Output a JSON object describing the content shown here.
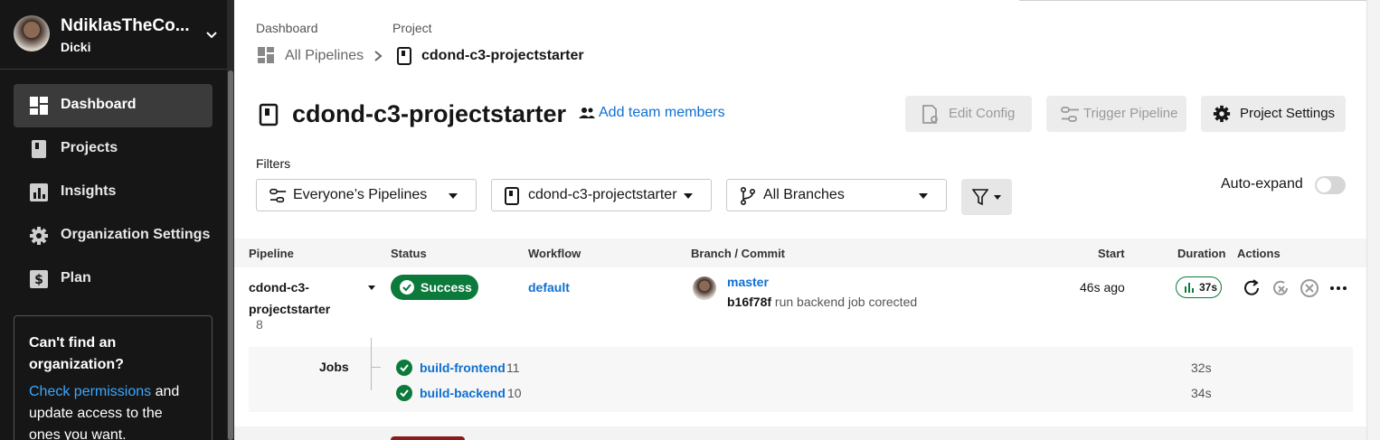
{
  "org": {
    "name": "NdiklasTheCo...",
    "user": "Dicki"
  },
  "sidebar": {
    "items": [
      {
        "label": "Dashboard",
        "icon": "dashboard-icon",
        "active": true
      },
      {
        "label": "Projects",
        "icon": "projects-icon"
      },
      {
        "label": "Insights",
        "icon": "insights-icon"
      },
      {
        "label": "Organization Settings",
        "icon": "gear-icon"
      },
      {
        "label": "Plan",
        "icon": "dollar-icon"
      }
    ],
    "help": {
      "heading": "Can't find an organization?",
      "link": "Check permissions",
      "text": " and update access to the ones you want."
    }
  },
  "breadcrumb": {
    "dashboard_label": "Dashboard",
    "project_label": "Project",
    "dashboard_value": "All Pipelines",
    "project_value": "cdond-c3-projectstarter"
  },
  "header": {
    "title": "cdond-c3-projectstarter",
    "add_team": "Add team members",
    "edit_config": "Edit Config",
    "trigger_pipeline": "Trigger Pipeline",
    "project_settings": "Project Settings"
  },
  "filters": {
    "label": "Filters",
    "pipelines": "Everyone’s Pipelines",
    "project": "cdond-c3-projectstarter",
    "branches": "All Branches",
    "auto_expand": "Auto-expand"
  },
  "table": {
    "headers": [
      "Pipeline",
      "Status",
      "Workflow",
      "Branch / Commit",
      "Start",
      "Duration",
      "Actions"
    ],
    "row": {
      "pipeline": "cdond-c3-projectstarter",
      "number": "8",
      "status": "Success",
      "workflow": "default",
      "branch": "master",
      "commit_hash": "b16f78f",
      "commit_msg": "run backend job corected",
      "start": "46s ago",
      "duration": "37s"
    },
    "jobs_label": "Jobs",
    "jobs": [
      {
        "name": "build-frontend",
        "number": "11",
        "duration": "32s"
      },
      {
        "name": "build-backend",
        "number": "10",
        "duration": "34s"
      }
    ]
  },
  "colors": {
    "success": "#0b7a3b",
    "link": "#0f6fd1",
    "sidebar": "#161616"
  }
}
